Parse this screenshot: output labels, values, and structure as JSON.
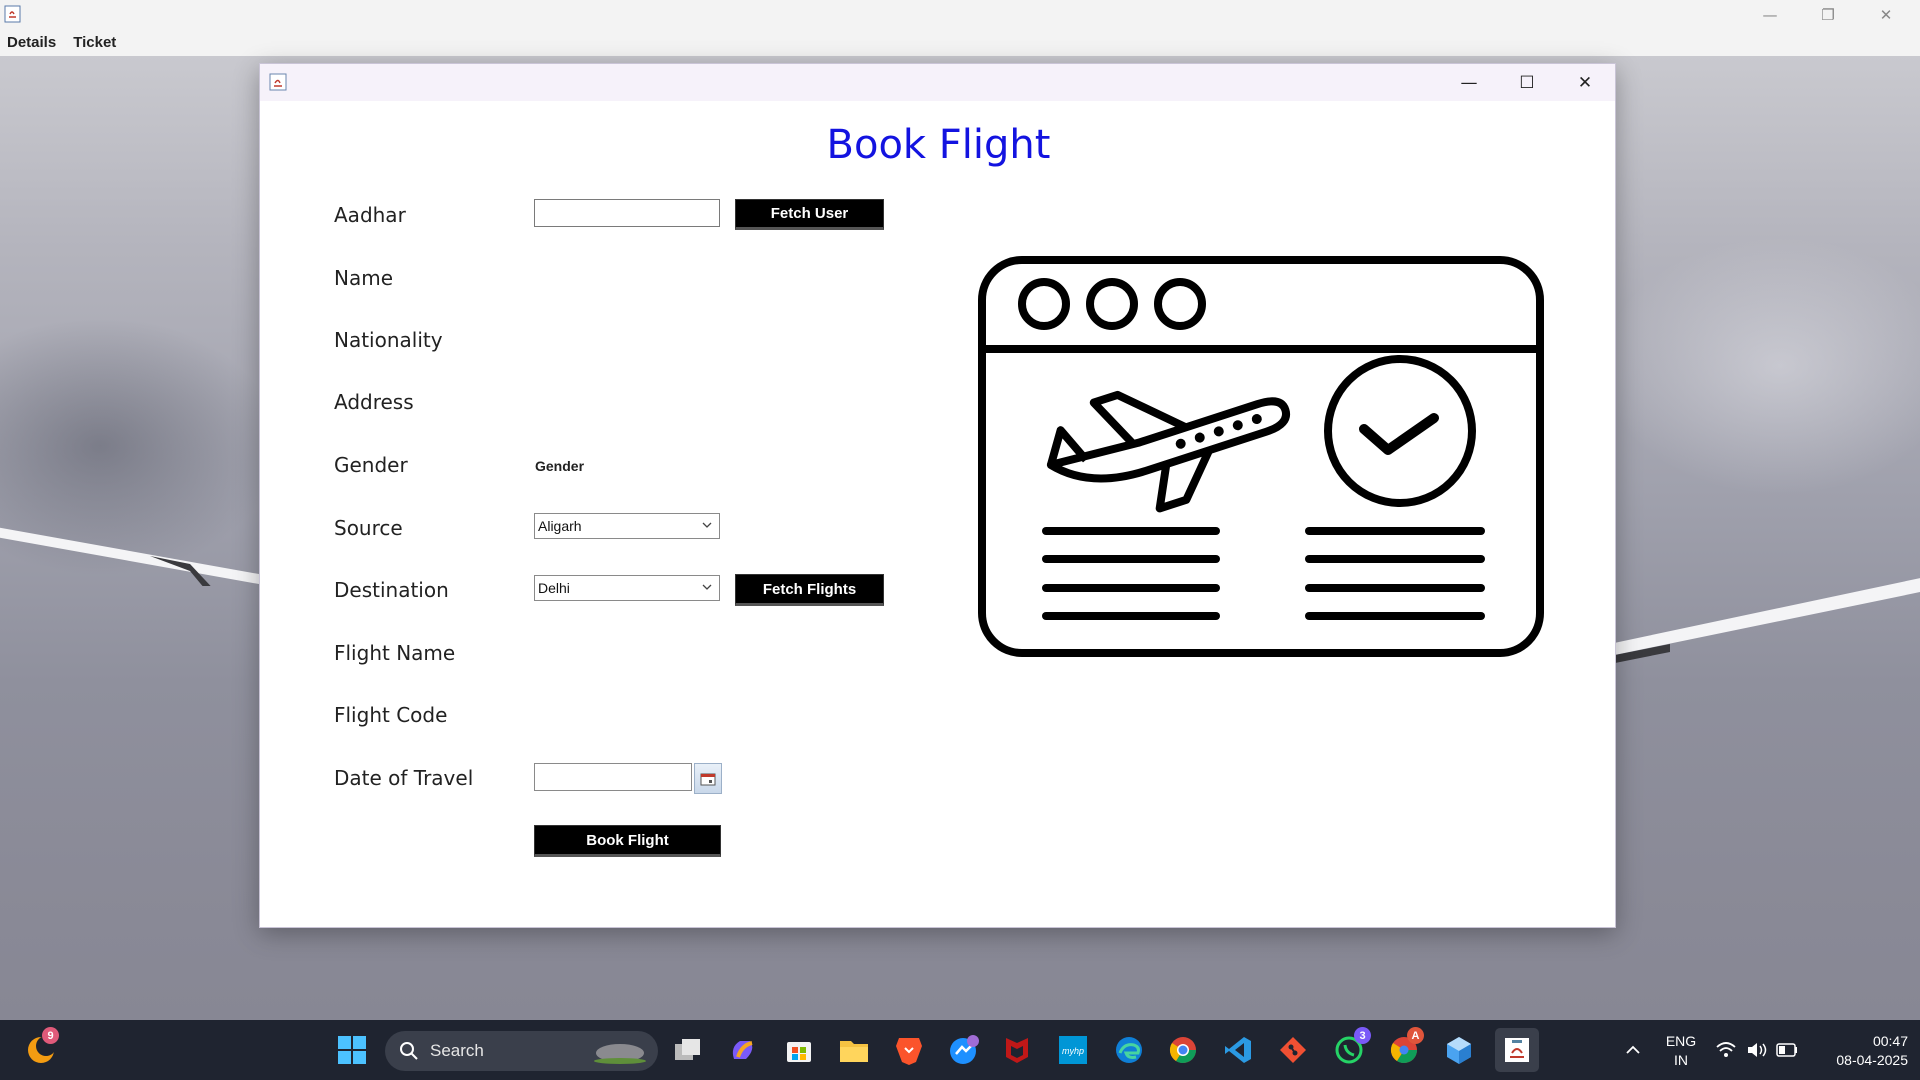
{
  "outer_window": {
    "menu": [
      "Details",
      "Ticket"
    ],
    "controls": {
      "minimize": "—",
      "restore": "❐",
      "close": "✕"
    }
  },
  "dialog": {
    "controls": {
      "minimize": "—",
      "maximize": "☐",
      "close": "✕"
    },
    "title": "Book Flight",
    "labels": {
      "aadhar": "Aadhar",
      "name": "Name",
      "nationality": "Nationality",
      "address": "Address",
      "gender": "Gender",
      "source": "Source",
      "destination": "Destination",
      "flight_name": "Flight Name",
      "flight_code": "Flight Code",
      "date_of_travel": "Date of Travel"
    },
    "aadhar_value": "",
    "gender_value": "Gender",
    "source_selected": "Aligarh",
    "destination_selected": "Delhi",
    "buttons": {
      "fetch_user": "Fetch User",
      "fetch_flights": "Fetch Flights",
      "book_flight": "Book Flight"
    },
    "illustration_icon": "flight-booking-icon"
  },
  "taskbar": {
    "search_label": "Search",
    "badges": {
      "app_left": "9",
      "whatsapp": "3",
      "chrome_profile": "A"
    },
    "language": [
      "ENG",
      "IN"
    ],
    "time": "00:47",
    "date": "08-04-2025",
    "icons": [
      "start-icon",
      "search-icon",
      "task-view-icon",
      "copilot-icon",
      "store-icon",
      "file-explorer-icon",
      "brave-icon",
      "messenger-icon",
      "mcafee-icon",
      "myhp-icon",
      "edge-icon",
      "chrome-icon",
      "vscode-icon",
      "git-icon",
      "whatsapp-icon",
      "chrome-profile-icon",
      "app-cube-icon",
      "java-icon"
    ],
    "colors": {
      "accent": "#1313e0",
      "taskbar": "#1f2430"
    }
  }
}
